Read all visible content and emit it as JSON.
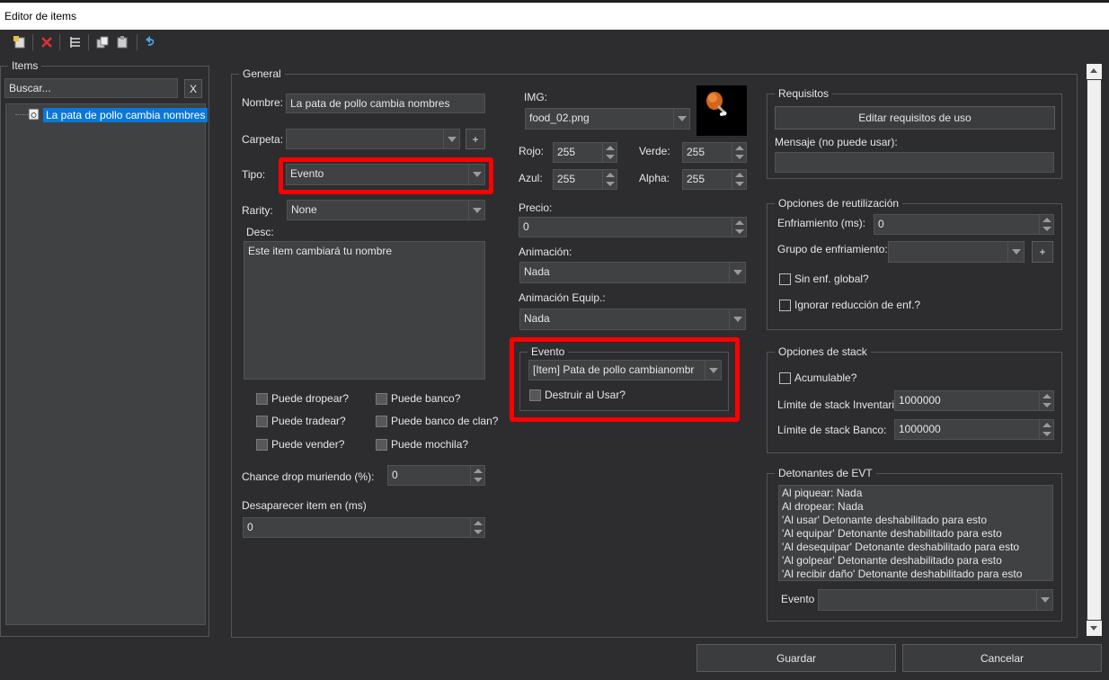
{
  "window": {
    "title": "Editor de items"
  },
  "toolbar": {
    "icons": [
      "new-item-icon",
      "delete-icon",
      "list-icon",
      "copy-icon",
      "paste-icon",
      "undo-icon"
    ]
  },
  "items_panel": {
    "title": "Items",
    "search_placeholder": "Buscar...",
    "clear_label": "X",
    "tree": [
      {
        "label": "La pata de pollo cambia nombres",
        "selected": true
      }
    ]
  },
  "general": {
    "title": "General",
    "name_label": "Nombre:",
    "name_value": "La pata de pollo cambia nombres",
    "folder_label": "Carpeta:",
    "folder_value": "",
    "folder_add": "+",
    "type_label": "Tipo:",
    "type_value": "Evento",
    "rarity_label": "Rarity:",
    "rarity_value": "None",
    "desc_label": "Desc:",
    "desc_value": "Este item cambiará tu nombre",
    "checkboxes": [
      {
        "label": "Puede dropear?"
      },
      {
        "label": "Puede banco?"
      },
      {
        "label": "Puede tradear?"
      },
      {
        "label": "Puede banco de clan?"
      },
      {
        "label": "Puede vender?"
      },
      {
        "label": "Puede mochila?"
      }
    ],
    "drop_chance_label": "Chance drop muriendo (%):",
    "drop_chance_value": "0",
    "despawn_label": "Desaparecer item en (ms)",
    "despawn_value": "0"
  },
  "appearance": {
    "img_label": "IMG:",
    "img_value": "food_02.png",
    "red_label": "Rojo:",
    "red_value": "255",
    "green_label": "Verde:",
    "green_value": "255",
    "blue_label": "Azul:",
    "blue_value": "255",
    "alpha_label": "Alpha:",
    "alpha_value": "255",
    "price_label": "Precio:",
    "price_value": "0",
    "animation_label": "Animación:",
    "animation_value": "Nada",
    "equip_animation_label": "Animación Equip.:",
    "equip_animation_value": "Nada"
  },
  "event_group": {
    "title": "Evento",
    "event_value": "[Item] Pata de pollo cambianombr",
    "destroy_label": "Destruir al Usar?"
  },
  "requirements": {
    "title": "Requisitos",
    "edit_button": "Editar requisitos de uso",
    "message_label": "Mensaje (no puede usar):",
    "message_value": ""
  },
  "reuse": {
    "title": "Opciones de reutilización",
    "cooldown_label": "Enfriamiento (ms):",
    "cooldown_value": "0",
    "cooldown_group_label": "Grupo de enfriamiento:",
    "cooldown_group_value": "",
    "add_label": "+",
    "no_global_label": "Sin enf. global?",
    "ignore_reduction_label": "Ignorar reducción de enf.?"
  },
  "stack": {
    "title": "Opciones de stack",
    "stackable_label": "Acumulable?",
    "inventory_limit_label": "Límite de stack Inventario:",
    "inventory_limit_value": "1000000",
    "bank_limit_label": "Límite de stack Banco:",
    "bank_limit_value": "1000000"
  },
  "triggers": {
    "title": "Detonantes de EVT",
    "lines": [
      "Al piquear: Nada",
      "Al dropear: Nada",
      "'Al usar' Detonante deshabilitado para esto",
      "'Al equipar' Detonante deshabilitado para esto",
      "'Al desequipar' Detonante deshabilitado para esto",
      "'Al golpear' Detonante deshabilitado para esto",
      "'Al recibir daño' Detonante deshabilitado para esto"
    ],
    "event_label": "Evento",
    "event_value": ""
  },
  "footer": {
    "save_label": "Guardar",
    "cancel_label": "Cancelar"
  }
}
